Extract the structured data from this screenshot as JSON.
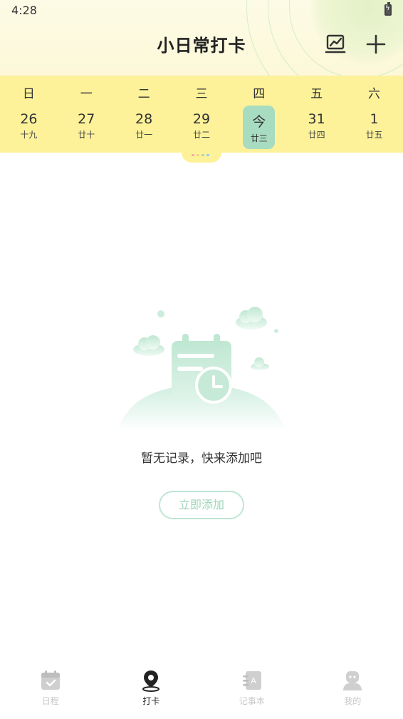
{
  "status_bar": {
    "time": "4:28"
  },
  "header": {
    "title": "小日常打卡",
    "stats_icon": "chart-icon",
    "add_icon": "plus-icon"
  },
  "calendar": {
    "weekdays": [
      "日",
      "一",
      "二",
      "三",
      "四",
      "五",
      "六"
    ],
    "days": [
      {
        "num": "26",
        "lunar": "十九"
      },
      {
        "num": "27",
        "lunar": "廿十"
      },
      {
        "num": "28",
        "lunar": "廿一"
      },
      {
        "num": "29",
        "lunar": "廿二"
      },
      {
        "num": "今",
        "lunar": "廿三"
      },
      {
        "num": "31",
        "lunar": "廿四"
      },
      {
        "num": "1",
        "lunar": "廿五"
      }
    ],
    "today_color": "#a8dcc0",
    "background": "#fdf29a"
  },
  "empty_state": {
    "message": "暂无记录，快来添加吧",
    "button": "立即添加"
  },
  "tabs": [
    {
      "label": "日程",
      "icon": "calendar-check-icon"
    },
    {
      "label": "打卡",
      "icon": "location-pin-icon"
    },
    {
      "label": "记事本",
      "icon": "notebook-icon"
    },
    {
      "label": "我的",
      "icon": "profile-icon"
    }
  ],
  "colors": {
    "accent": "#a8dcc0",
    "accent_text": "#9fd6bb",
    "inactive": "#c8c8c8"
  }
}
